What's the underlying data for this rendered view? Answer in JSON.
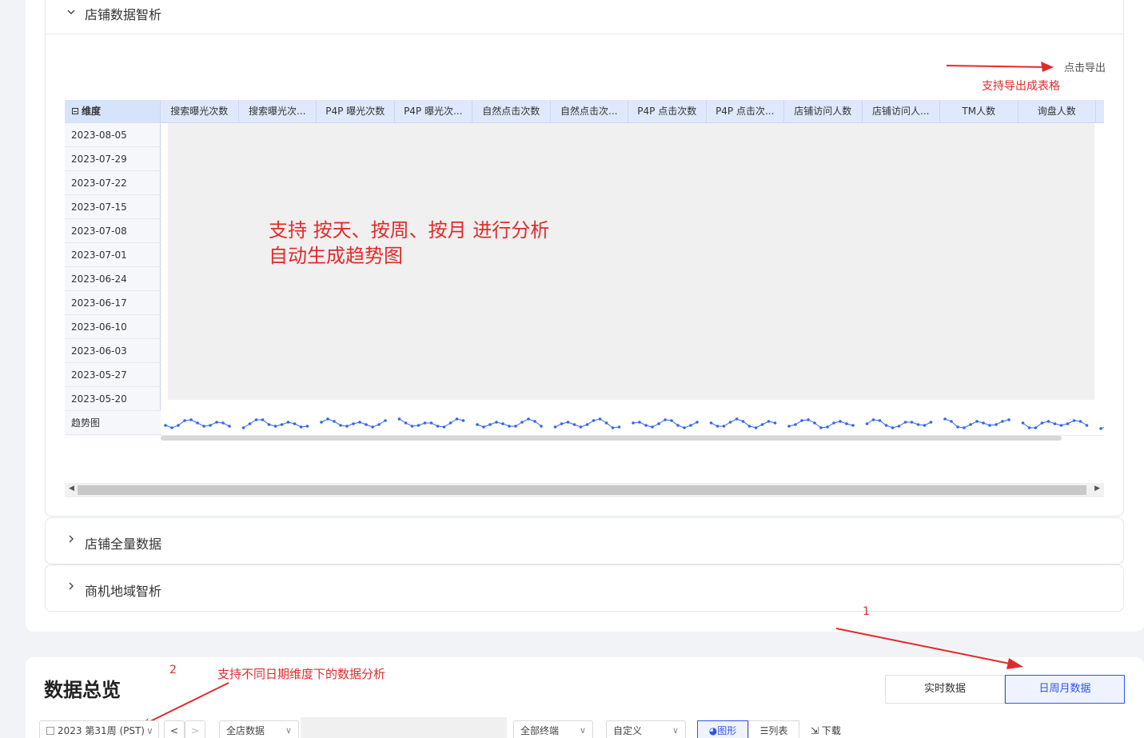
{
  "sections": {
    "first": {
      "title": "店铺数据智析",
      "expanded": true
    },
    "second": {
      "title": "店铺全量数据",
      "expanded": false
    },
    "third": {
      "title": "商机地域智析",
      "expanded": false
    }
  },
  "export_link": "点击导出",
  "annotations": {
    "export_note": "支持导出成表格",
    "trend_line1": "支持 按天、按周、按月  进行分析",
    "trend_line2": "自动生成趋势图",
    "number_1": "1",
    "number_2": "2",
    "date_note": "支持不同日期维度下的数据分析"
  },
  "table": {
    "dimension_header": "维度",
    "columns": [
      "搜索曝光次数",
      "搜索曝光次...",
      "P4P 曝光次数",
      "P4P 曝光次...",
      "自然点击次数",
      "自然点击次...",
      "P4P 点击次数",
      "P4P 点击次...",
      "店铺访问人数",
      "店铺访问人...",
      "TM人数",
      "询盘人数"
    ],
    "rows": [
      "2023-08-05",
      "2023-07-29",
      "2023-07-22",
      "2023-07-15",
      "2023-07-08",
      "2023-07-01",
      "2023-06-24",
      "2023-06-17",
      "2023-06-10",
      "2023-06-03",
      "2023-05-27",
      "2023-05-20"
    ],
    "trend_label": "趋势图"
  },
  "overview": {
    "title": "数据总览",
    "toggle": {
      "realtime": "实时数据",
      "periodic": "日周月数据",
      "selected": "periodic"
    },
    "controls": {
      "date_picker": "2023 第31周 (PST)",
      "prev": "<",
      "next": ">",
      "store_select": "全店数据",
      "terminal_select": "全部终端",
      "range_select": "自定义",
      "chart_tab": "图形",
      "list_tab": "列表",
      "download": "下载"
    }
  },
  "icons": {
    "expand": "chevron-down-icon",
    "collapse": "chevron-right-icon",
    "calendar": "calendar-icon",
    "chart": "pie-chart-icon",
    "list": "list-icon",
    "download": "export-icon"
  },
  "colors": {
    "annotation": "#e12b2b",
    "primary": "#2f54eb",
    "sparkline": "#3366ee",
    "header_bg": "#dfe9fb"
  }
}
